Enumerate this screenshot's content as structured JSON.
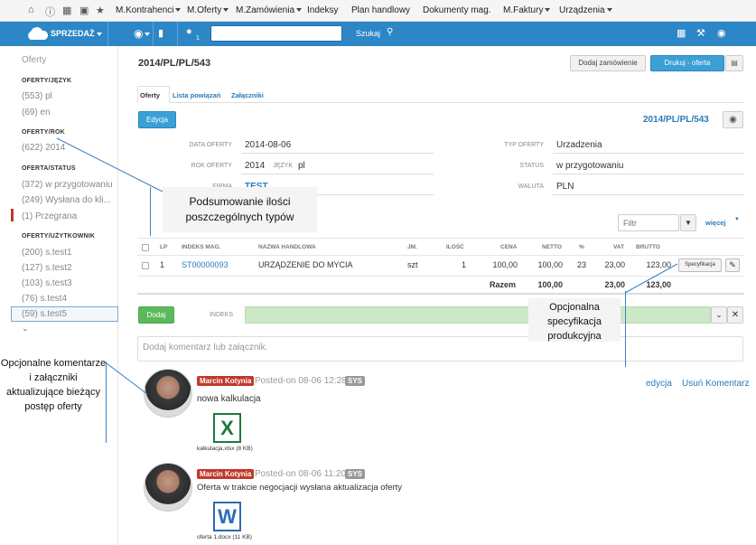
{
  "topmenu": {
    "items": [
      "M.Kontrahenci",
      "M.Oferty",
      "M.Zamówienia",
      "Indeksy",
      "Plan handlowy",
      "Dokumenty mag.",
      "M.Faktury",
      "Urządzenia"
    ]
  },
  "bluebar": {
    "app": "SPRZEDAŻ",
    "badge": "1",
    "search_button": "Szukaj",
    "search_value": ""
  },
  "sidebar": {
    "title": "Oferty",
    "sections": [
      {
        "header": "OFERTY/JĘZYK",
        "items": [
          "(553) pl",
          "(69) en"
        ]
      },
      {
        "header": "OFERTY/ROK",
        "items": [
          "(622) 2014"
        ]
      },
      {
        "header": "OFERTA/STATUS",
        "items": [
          "(372) w przygotowaniu",
          "(249) Wysłana do kli...",
          "(1) Przegrana"
        ]
      },
      {
        "header": "OFERTY/UŻYTKOWNIK",
        "items": [
          "(200) s.test1",
          "(127) s.test2",
          "(103) s.test3",
          "(76) s.test4",
          "(59) s.test5"
        ]
      }
    ]
  },
  "header": {
    "title": "2014/PL/PL/543",
    "add_order": "Dodaj zamówienie",
    "print": "Drukuj - oferta"
  },
  "tabs": [
    "Oferty",
    "Lista powiązań",
    "Załączniki"
  ],
  "edit_button": "Edycja",
  "doc_number": "2014/PL/PL/543",
  "fields": {
    "data_label": "DATA OFERTY",
    "data_value": "2014-08-06",
    "rok_label": "ROK OFERTY",
    "rok_value": "2014",
    "jezyk_label": "JĘZYK",
    "jezyk_value": "pl",
    "firma_label": "FIRMA",
    "firma_value": "TEST",
    "typ_label": "TYP OFERTY",
    "typ_value": "Urzadzenia",
    "status_label": "STATUS",
    "status_value": "w przygotowaniu",
    "waluta_label": "WALUTA",
    "waluta_value": "PLN"
  },
  "filter": {
    "placeholder": "Filtr",
    "more": "więcej"
  },
  "table": {
    "headers": [
      "LP",
      "INDEKS MAG.",
      "NAZWA HANDLOWA",
      "JM.",
      "ILOŚĆ",
      "CENA",
      "NETTO",
      "%",
      "VAT",
      "BRUTTO"
    ],
    "rows": [
      [
        "1",
        "ST00000093",
        "URZĄDZENIE DO MYCIA",
        "szt",
        "1",
        "100,00",
        "100,00",
        "23",
        "23,00",
        "123,00"
      ]
    ],
    "spec_button": "Specyfikacja",
    "total_label": "Razem",
    "total_netto": "100,00",
    "total_vat": "23,00",
    "total_brutto": "123,00"
  },
  "add_row": {
    "button": "Dodaj",
    "index_label": "INDEKS"
  },
  "comment": {
    "placeholder": "Dodaj komentarz lub załącznik."
  },
  "posts": [
    {
      "author": "Marcin Kotynia",
      "meta": "Posted-on 08-06 12:28",
      "tag": "SYS",
      "text": "nowa kalkulacja",
      "file": "kalkulacja.xlsx (8 KB)",
      "file_letter": "X",
      "file_color": "#1d7a3b",
      "edit": "edycja",
      "delete": "Usuń Komentarz"
    },
    {
      "author": "Marcin Kotynia",
      "meta": "Posted-on 08-06 11:20",
      "tag": "SYS",
      "text": "Oferta w trakcie negocjacji wysłana aktualizacja oferty",
      "file": "oferta 1.docx (11 KB)",
      "file_letter": "W",
      "file_color": "#2b6cb8"
    }
  ],
  "callouts": {
    "summary": "Podsumowanie ilości poszczególnych typów",
    "spec": "Opcjonalna specyfikacja produkcyjna",
    "comments": "Opcjonalne komentarze i załączniki aktualizujące bieżący postęp oferty"
  },
  "colors": {
    "primary": "#2d86c6",
    "success": "#5cb85c",
    "danger": "#c0392b",
    "link": "#2a7ab8"
  }
}
